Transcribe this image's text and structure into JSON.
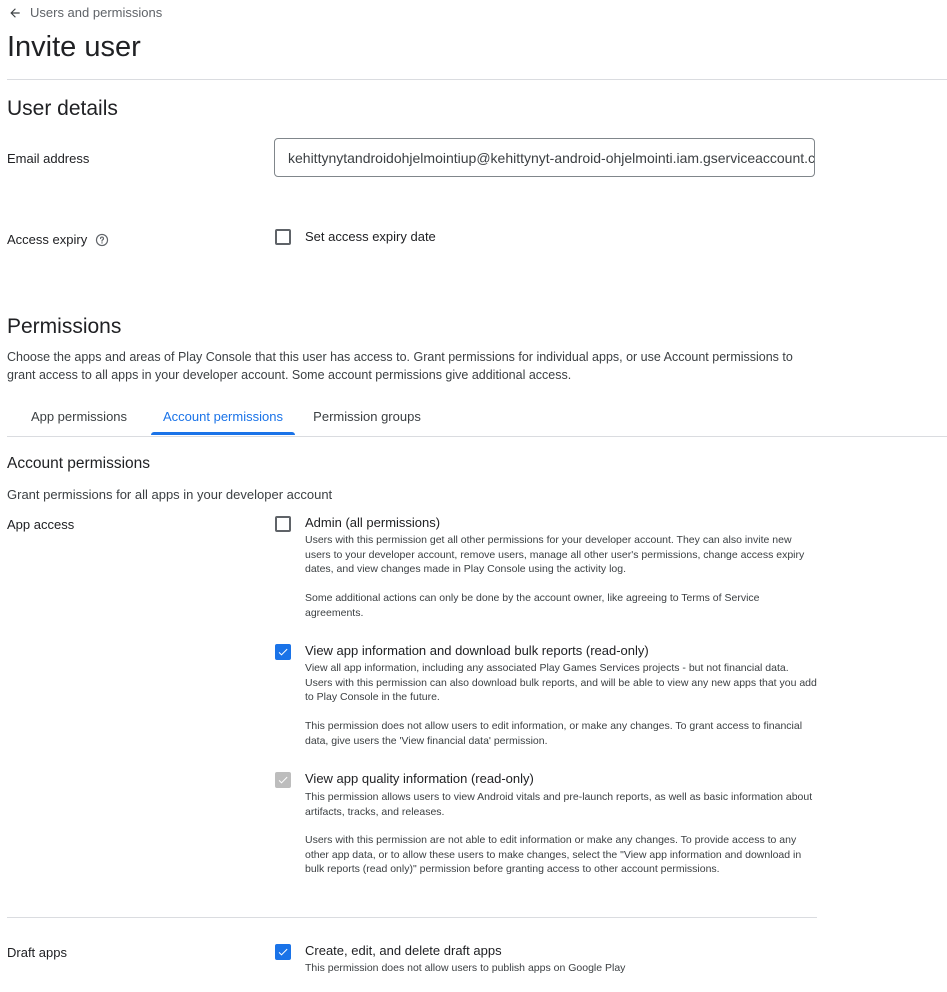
{
  "breadcrumb": {
    "back_label": "Users and permissions"
  },
  "page": {
    "title": "Invite user"
  },
  "user_details": {
    "section_title": "User details",
    "email_label": "Email address",
    "email_value": "kehittynytandroidohjelmointiup@kehittynyt-android-ohjelmointi.iam.gserviceaccount.com",
    "access_expiry_label": "Access expiry",
    "set_expiry_label": "Set access expiry date",
    "set_expiry_checked": false
  },
  "permissions": {
    "section_title": "Permissions",
    "description": "Choose the apps and areas of Play Console that this user has access to. Grant permissions for individual apps, or use Account permissions to grant access to all apps in your developer account. Some account permissions give additional access.",
    "tabs": [
      {
        "label": "App permissions",
        "active": false
      },
      {
        "label": "Account permissions",
        "active": true
      },
      {
        "label": "Permission groups",
        "active": false
      }
    ]
  },
  "account_permissions": {
    "title": "Account permissions",
    "subtitle": "Grant permissions for all apps in your developer account",
    "app_access_label": "App access",
    "items": [
      {
        "title": "Admin (all permissions)",
        "checked": false,
        "desc1": "Users with this permission get all other permissions for your developer account. They can also invite new users to your developer account, remove users, manage all other user's permissions, change access expiry dates, and view changes made in Play Console using the activity log.",
        "desc2": "Some additional actions can only be done by the account owner, like agreeing to Terms of Service agreements."
      },
      {
        "title": "View app information and download bulk reports (read-only)",
        "checked": true,
        "desc1": "View all app information, including any associated Play Games Services projects - but not financial data. Users with this permission can also download bulk reports, and will be able to view any new apps that you add to Play Console in the future.",
        "desc2": "This permission does not allow users to edit information, or make any changes. To grant access to financial data, give users the 'View financial data' permission."
      },
      {
        "title": "View app quality information (read-only)",
        "checked": true,
        "disabled": true,
        "desc1": "This permission allows users to view Android vitals and pre-launch reports, as well as basic information about artifacts, tracks, and releases.",
        "desc2": "Users with this permission are not able to edit information or make any changes. To provide access to any other app data, or to allow these users to make changes, select the \"View app information and download in bulk reports (read only)\" permission before granting access to other account permissions."
      }
    ],
    "draft_apps_label": "Draft apps",
    "draft_item": {
      "title": "Create, edit, and delete draft apps",
      "checked": true,
      "desc": "This permission does not allow users to publish apps on Google Play"
    }
  },
  "colors": {
    "accent": "#1a73e8",
    "disabled_check": "#bdbdbd",
    "divider": "#dadce0"
  },
  "icons": {
    "back": "arrow-left-icon",
    "help": "help-circle-icon",
    "check": "check-icon"
  }
}
